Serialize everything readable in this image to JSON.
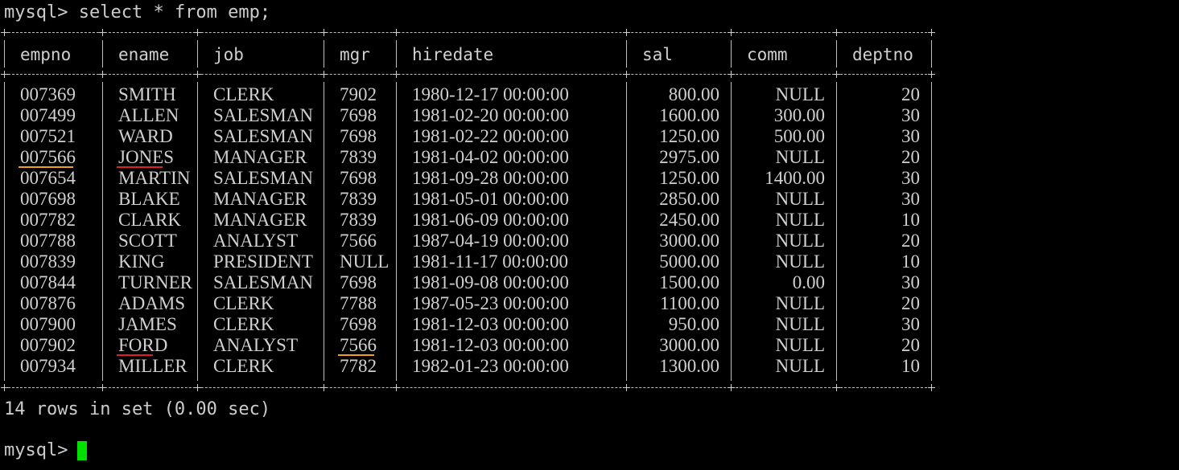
{
  "terminal": {
    "prompt": "mysql>",
    "command": "select * from emp;",
    "result_summary": "14 rows in set (0.00 sec)",
    "final_prompt": "mysql>",
    "cursor_color": "#00e000",
    "text_color": "#cccccc",
    "background": "#000000"
  },
  "table": {
    "columns": [
      "empno",
      "ename",
      "job",
      "mgr",
      "hiredate",
      "sal",
      "comm",
      "deptno"
    ],
    "rows": [
      [
        "007369",
        "SMITH",
        "CLERK",
        "7902",
        "1980-12-17 00:00:00",
        "800.00",
        "NULL",
        "20"
      ],
      [
        "007499",
        "ALLEN",
        "SALESMAN",
        "7698",
        "1981-02-20 00:00:00",
        "1600.00",
        "300.00",
        "30"
      ],
      [
        "007521",
        "WARD",
        "SALESMAN",
        "7698",
        "1981-02-22 00:00:00",
        "1250.00",
        "500.00",
        "30"
      ],
      [
        "007566",
        "JONES",
        "MANAGER",
        "7839",
        "1981-04-02 00:00:00",
        "2975.00",
        "NULL",
        "20"
      ],
      [
        "007654",
        "MARTIN",
        "SALESMAN",
        "7698",
        "1981-09-28 00:00:00",
        "1250.00",
        "1400.00",
        "30"
      ],
      [
        "007698",
        "BLAKE",
        "MANAGER",
        "7839",
        "1981-05-01 00:00:00",
        "2850.00",
        "NULL",
        "30"
      ],
      [
        "007782",
        "CLARK",
        "MANAGER",
        "7839",
        "1981-06-09 00:00:00",
        "2450.00",
        "NULL",
        "10"
      ],
      [
        "007788",
        "SCOTT",
        "ANALYST",
        "7566",
        "1987-04-19 00:00:00",
        "3000.00",
        "NULL",
        "20"
      ],
      [
        "007839",
        "KING",
        "PRESIDENT",
        "NULL",
        "1981-11-17 00:00:00",
        "5000.00",
        "NULL",
        "10"
      ],
      [
        "007844",
        "TURNER",
        "SALESMAN",
        "7698",
        "1981-09-08 00:00:00",
        "1500.00",
        "0.00",
        "30"
      ],
      [
        "007876",
        "ADAMS",
        "CLERK",
        "7788",
        "1987-05-23 00:00:00",
        "1100.00",
        "NULL",
        "20"
      ],
      [
        "007900",
        "JAMES",
        "CLERK",
        "7698",
        "1981-12-03 00:00:00",
        "950.00",
        "NULL",
        "30"
      ],
      [
        "007902",
        "FORD",
        "ANALYST",
        "7566",
        "1981-12-03 00:00:00",
        "3000.00",
        "NULL",
        "20"
      ],
      [
        "007934",
        "MILLER",
        "CLERK",
        "7782",
        "1982-01-23 00:00:00",
        "1300.00",
        "NULL",
        "10"
      ]
    ],
    "annotations": [
      {
        "row": 3,
        "column": "empno",
        "color": "#f0a020"
      },
      {
        "row": 3,
        "column": "ename",
        "color": "#e02020"
      },
      {
        "row": 12,
        "column": "ename",
        "color": "#e02020"
      },
      {
        "row": 12,
        "column": "mgr",
        "color": "#f0a020"
      }
    ]
  }
}
